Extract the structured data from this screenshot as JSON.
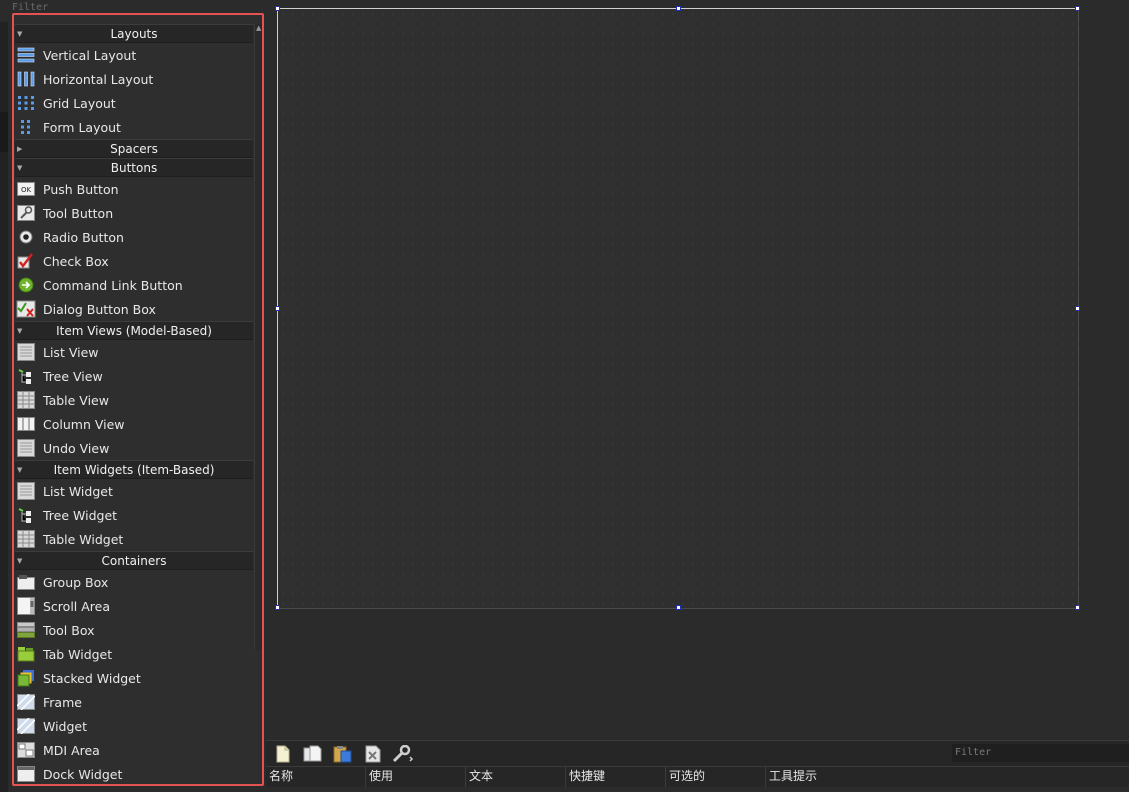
{
  "widget_box": {
    "filter_placeholder": "Filter",
    "categories": [
      {
        "label": "Layouts",
        "items": [
          {
            "label": "Vertical Layout",
            "icon": "vertical-layout-icon"
          },
          {
            "label": "Horizontal Layout",
            "icon": "horizontal-layout-icon"
          },
          {
            "label": "Grid Layout",
            "icon": "grid-layout-icon"
          },
          {
            "label": "Form Layout",
            "icon": "form-layout-icon"
          }
        ]
      },
      {
        "label": "Spacers",
        "items": []
      },
      {
        "label": "Buttons",
        "items": [
          {
            "label": "Push Button",
            "icon": "push-button-icon"
          },
          {
            "label": "Tool Button",
            "icon": "tool-button-icon"
          },
          {
            "label": "Radio Button",
            "icon": "radio-button-icon"
          },
          {
            "label": "Check Box",
            "icon": "check-box-icon"
          },
          {
            "label": "Command Link Button",
            "icon": "command-link-icon"
          },
          {
            "label": "Dialog Button Box",
            "icon": "dialog-button-box-icon"
          }
        ]
      },
      {
        "label": "Item Views (Model-Based)",
        "items": [
          {
            "label": "List View",
            "icon": "list-view-icon"
          },
          {
            "label": "Tree View",
            "icon": "tree-view-icon"
          },
          {
            "label": "Table View",
            "icon": "table-view-icon"
          },
          {
            "label": "Column View",
            "icon": "column-view-icon"
          },
          {
            "label": "Undo View",
            "icon": "undo-view-icon"
          }
        ]
      },
      {
        "label": "Item Widgets (Item-Based)",
        "items": [
          {
            "label": "List Widget",
            "icon": "list-widget-icon"
          },
          {
            "label": "Tree Widget",
            "icon": "tree-widget-icon"
          },
          {
            "label": "Table Widget",
            "icon": "table-widget-icon"
          }
        ]
      },
      {
        "label": "Containers",
        "items": [
          {
            "label": "Group Box",
            "icon": "group-box-icon"
          },
          {
            "label": "Scroll Area",
            "icon": "scroll-area-icon"
          },
          {
            "label": "Tool Box",
            "icon": "tool-box-icon"
          },
          {
            "label": "Tab Widget",
            "icon": "tab-widget-icon"
          },
          {
            "label": "Stacked Widget",
            "icon": "stacked-widget-icon"
          },
          {
            "label": "Frame",
            "icon": "frame-icon"
          },
          {
            "label": "Widget",
            "icon": "widget-icon"
          },
          {
            "label": "MDI Area",
            "icon": "mdi-area-icon"
          },
          {
            "label": "Dock Widget",
            "icon": "dock-widget-icon"
          }
        ]
      }
    ]
  },
  "action_editor": {
    "toolbar": [
      "new-action-icon",
      "copy-action-icon",
      "paste-action-icon",
      "delete-action-icon",
      "configure-icon"
    ],
    "filter_placeholder": "Filter",
    "columns": [
      "名称",
      "使用",
      "文本",
      "快捷键",
      "可选的",
      "工具提示"
    ]
  },
  "colors": {
    "highlight_border": "#e45252",
    "handle_border": "#1c2fb6",
    "background": "#2b2b2b"
  }
}
